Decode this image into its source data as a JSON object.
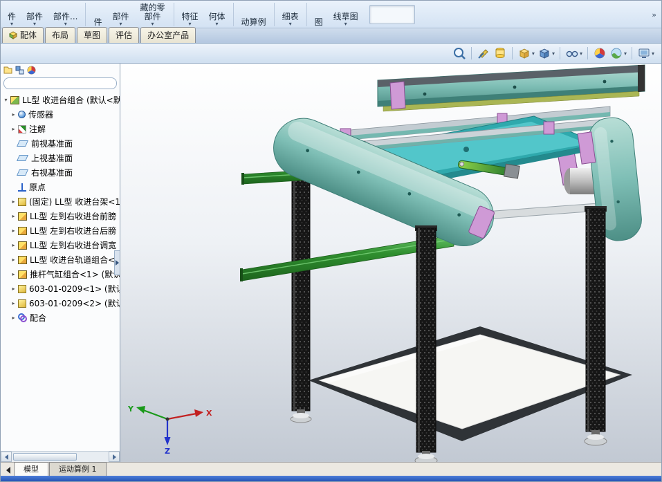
{
  "ribbon": {
    "buttons": [
      {
        "label": "件",
        "caret": true
      },
      {
        "label": "部件",
        "caret": true
      },
      {
        "label": "部件...",
        "caret": true
      },
      {
        "label": "件",
        "caret": false
      },
      {
        "label": "部件",
        "caret": true
      },
      {
        "label": "藏的零部件",
        "caret": true
      },
      {
        "label": "特征",
        "caret": true
      },
      {
        "label": "何体",
        "caret": true
      },
      {
        "label": "动算例",
        "caret": false
      },
      {
        "label": "细表",
        "caret": true
      },
      {
        "label": "图",
        "caret": false
      },
      {
        "label": "线草图",
        "caret": true
      }
    ]
  },
  "tabs": {
    "items": [
      "配体",
      "布局",
      "草图",
      "评估",
      "办公室产品"
    ]
  },
  "view_toolbar": {
    "icons": [
      "zoom-to-fit",
      "section-view",
      "view-orientation",
      "display-style",
      "shaded-cube",
      "hide-show-items",
      "edit-appearance",
      "apply-scene",
      "view-settings"
    ]
  },
  "panel": {
    "tab_icons": [
      "featuremanager",
      "propertymanager",
      "configurationmanager"
    ],
    "filter": {
      "value": ""
    }
  },
  "tree": {
    "items": [
      {
        "label": "LL型 收进台组合 (默认<默",
        "icon": "assembly",
        "state": "expanded"
      },
      {
        "label": "传感器",
        "icon": "sensors",
        "state": "collapsed"
      },
      {
        "label": "注解",
        "icon": "annotations",
        "state": "collapsed"
      },
      {
        "label": "前视基准面",
        "icon": "plane",
        "state": "leaf"
      },
      {
        "label": "上视基准面",
        "icon": "plane",
        "state": "leaf"
      },
      {
        "label": "右视基准面",
        "icon": "plane",
        "state": "leaf"
      },
      {
        "label": "原点",
        "icon": "origin",
        "state": "leaf"
      },
      {
        "label": "(固定) LL型 收进台架<1",
        "icon": "part",
        "state": "collapsed"
      },
      {
        "label": "LL型 左到右收进台前膀",
        "icon": "subassembly",
        "state": "collapsed"
      },
      {
        "label": "LL型 左到右收进台后膀",
        "icon": "subassembly",
        "state": "collapsed"
      },
      {
        "label": "LL型 左到右收进台调宽",
        "icon": "subassembly",
        "state": "collapsed"
      },
      {
        "label": "LL型 收进台轨道组合<1",
        "icon": "subassembly",
        "state": "collapsed"
      },
      {
        "label": "推杆气缸组合<1> (默认",
        "icon": "subassembly",
        "state": "collapsed"
      },
      {
        "label": "603-01-0209<1> (默认",
        "icon": "part",
        "state": "collapsed"
      },
      {
        "label": "603-01-0209<2> (默认",
        "icon": "part",
        "state": "collapsed"
      },
      {
        "label": "配合",
        "icon": "mates",
        "state": "collapsed"
      }
    ]
  },
  "viewport": {
    "triad": {
      "x": "X",
      "y": "Y",
      "z": "Z"
    }
  },
  "bottom_tabs": {
    "items": [
      "模型",
      "运动算例 1"
    ]
  },
  "colors": {
    "cover_teal": "#7fc0b8",
    "table_cyan": "#45c0c4",
    "rail_green": "#2f8f2f",
    "accent_purple": "#cf9ad6",
    "leg_dark": "#1c1c1c",
    "status_blue": "#2a5ac8"
  }
}
